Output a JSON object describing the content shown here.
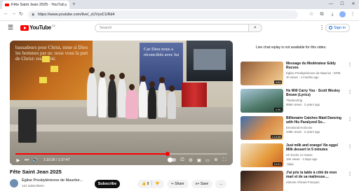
{
  "browser": {
    "tab_title": "Fête Saint Jean 2025 - YouTube",
    "url": "https://www.youtube.com/live/_xUVyoCURd4"
  },
  "youtube": {
    "logo_text": "YouTube",
    "logo_country": "CA",
    "search_placeholder": "Search",
    "signin_label": "Sign in"
  },
  "player": {
    "time_display": "1:10:26 / 1:37:47",
    "progress_fraction": 0.72,
    "banner_left_text": "bassadeurs pour Christ, mme si Dieu les hommes par us: nous vous la part de Christ: ressuscité.",
    "banner_center_text": "Car Dieu nous a réconciliés avec lui",
    "accent_color": "#ff0000"
  },
  "video": {
    "title": "Fête Saint Jean 2025",
    "channel_name": "Église Presbytérienne de Mauritor...",
    "subscribers": "131 subscribers",
    "subscribe_label": "Subscribe",
    "like_count": "9",
    "share_label": "Share",
    "save_label": "Save",
    "more_label": "..."
  },
  "sidebar": {
    "live_note": "Live chat replay is not available for this video.",
    "items": [
      {
        "title": "Message du Modérateur Eddy Rocves",
        "channel": "Église Presbytérienne de Maurice - EPM",
        "meta": "40 views · 4 months ago",
        "duration": "4:04"
      },
      {
        "title": "He Will Carry You · Scott Wesley Brown (Lyrics)",
        "channel": "TheWorship",
        "meta": "966K views · 2 years ago",
        "duration": "4:36"
      },
      {
        "title": "Billionaire Catches Maid Dancing with His Paralyzed So...",
        "channel": "Emotional Horizons",
        "meta": "248K views · 2 years ago",
        "duration": "1:14:48"
      },
      {
        "title": "Just milk and orange! No eggs! Milk dessert in 5 minutes",
        "channel": "Ich koche zu Hause",
        "meta": "15K views · 4 days ago",
        "duration": "10:21",
        "badge": "New"
      },
      {
        "title": "J'ai pris la table à côté de mon mari et de sa maitresse....",
        "channel": "Histoire Africain Français",
        "meta": "",
        "duration": ""
      }
    ]
  }
}
